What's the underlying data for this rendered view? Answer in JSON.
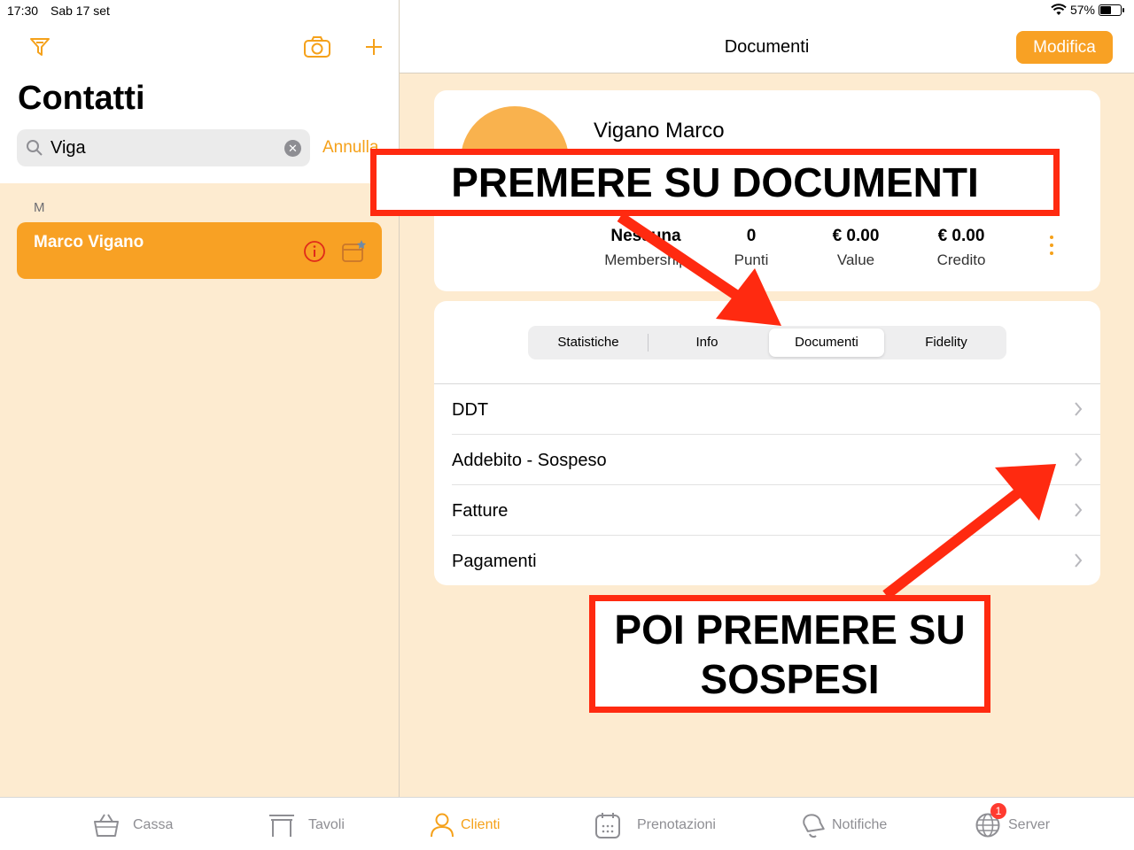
{
  "status_bar": {
    "time": "17:30",
    "date": "Sab 17 set",
    "battery": "57%",
    "battery_level": 0.57
  },
  "contacts_panel": {
    "title": "Contatti",
    "search": {
      "value": "Viga",
      "cancel_label": "Annulla"
    },
    "section_letter": "M",
    "contacts": [
      {
        "name": "Marco Vigano"
      }
    ]
  },
  "detail": {
    "nav_title": "Documenti",
    "edit_button": "Modifica",
    "customer": {
      "name": "Vigano Marco",
      "stats": [
        {
          "value": "Nessuna",
          "label": "Membership"
        },
        {
          "value": "0",
          "label": "Punti"
        },
        {
          "value": "€ 0.00",
          "label": "Value"
        },
        {
          "value": "€ 0.00",
          "label": "Credito"
        }
      ]
    },
    "segments": [
      "Statistiche",
      "Info",
      "Documenti",
      "Fidelity"
    ],
    "selected_segment": "Documenti",
    "documents": [
      "DDT",
      "Addebito - Sospeso",
      "Fatture",
      "Pagamenti"
    ]
  },
  "annotations": {
    "first": "PREMERE SU DOCUMENTI",
    "second": "POI PREMERE SU SOSPESI"
  },
  "tab_bar": {
    "tabs": [
      {
        "label": "Cassa",
        "icon": "basket-icon"
      },
      {
        "label": "Tavoli",
        "icon": "table-icon"
      },
      {
        "label": "Clienti",
        "icon": "person-icon"
      },
      {
        "label": "Prenotazioni",
        "icon": "calendar-icon"
      },
      {
        "label": "Notifiche",
        "icon": "bell-icon"
      },
      {
        "label": "Server",
        "icon": "globe-icon"
      }
    ],
    "active": "Clienti",
    "server_badge": "1"
  },
  "colors": {
    "accent": "#f8a124",
    "background": "#fdebd0",
    "annotation_red": "#ff2a10"
  }
}
